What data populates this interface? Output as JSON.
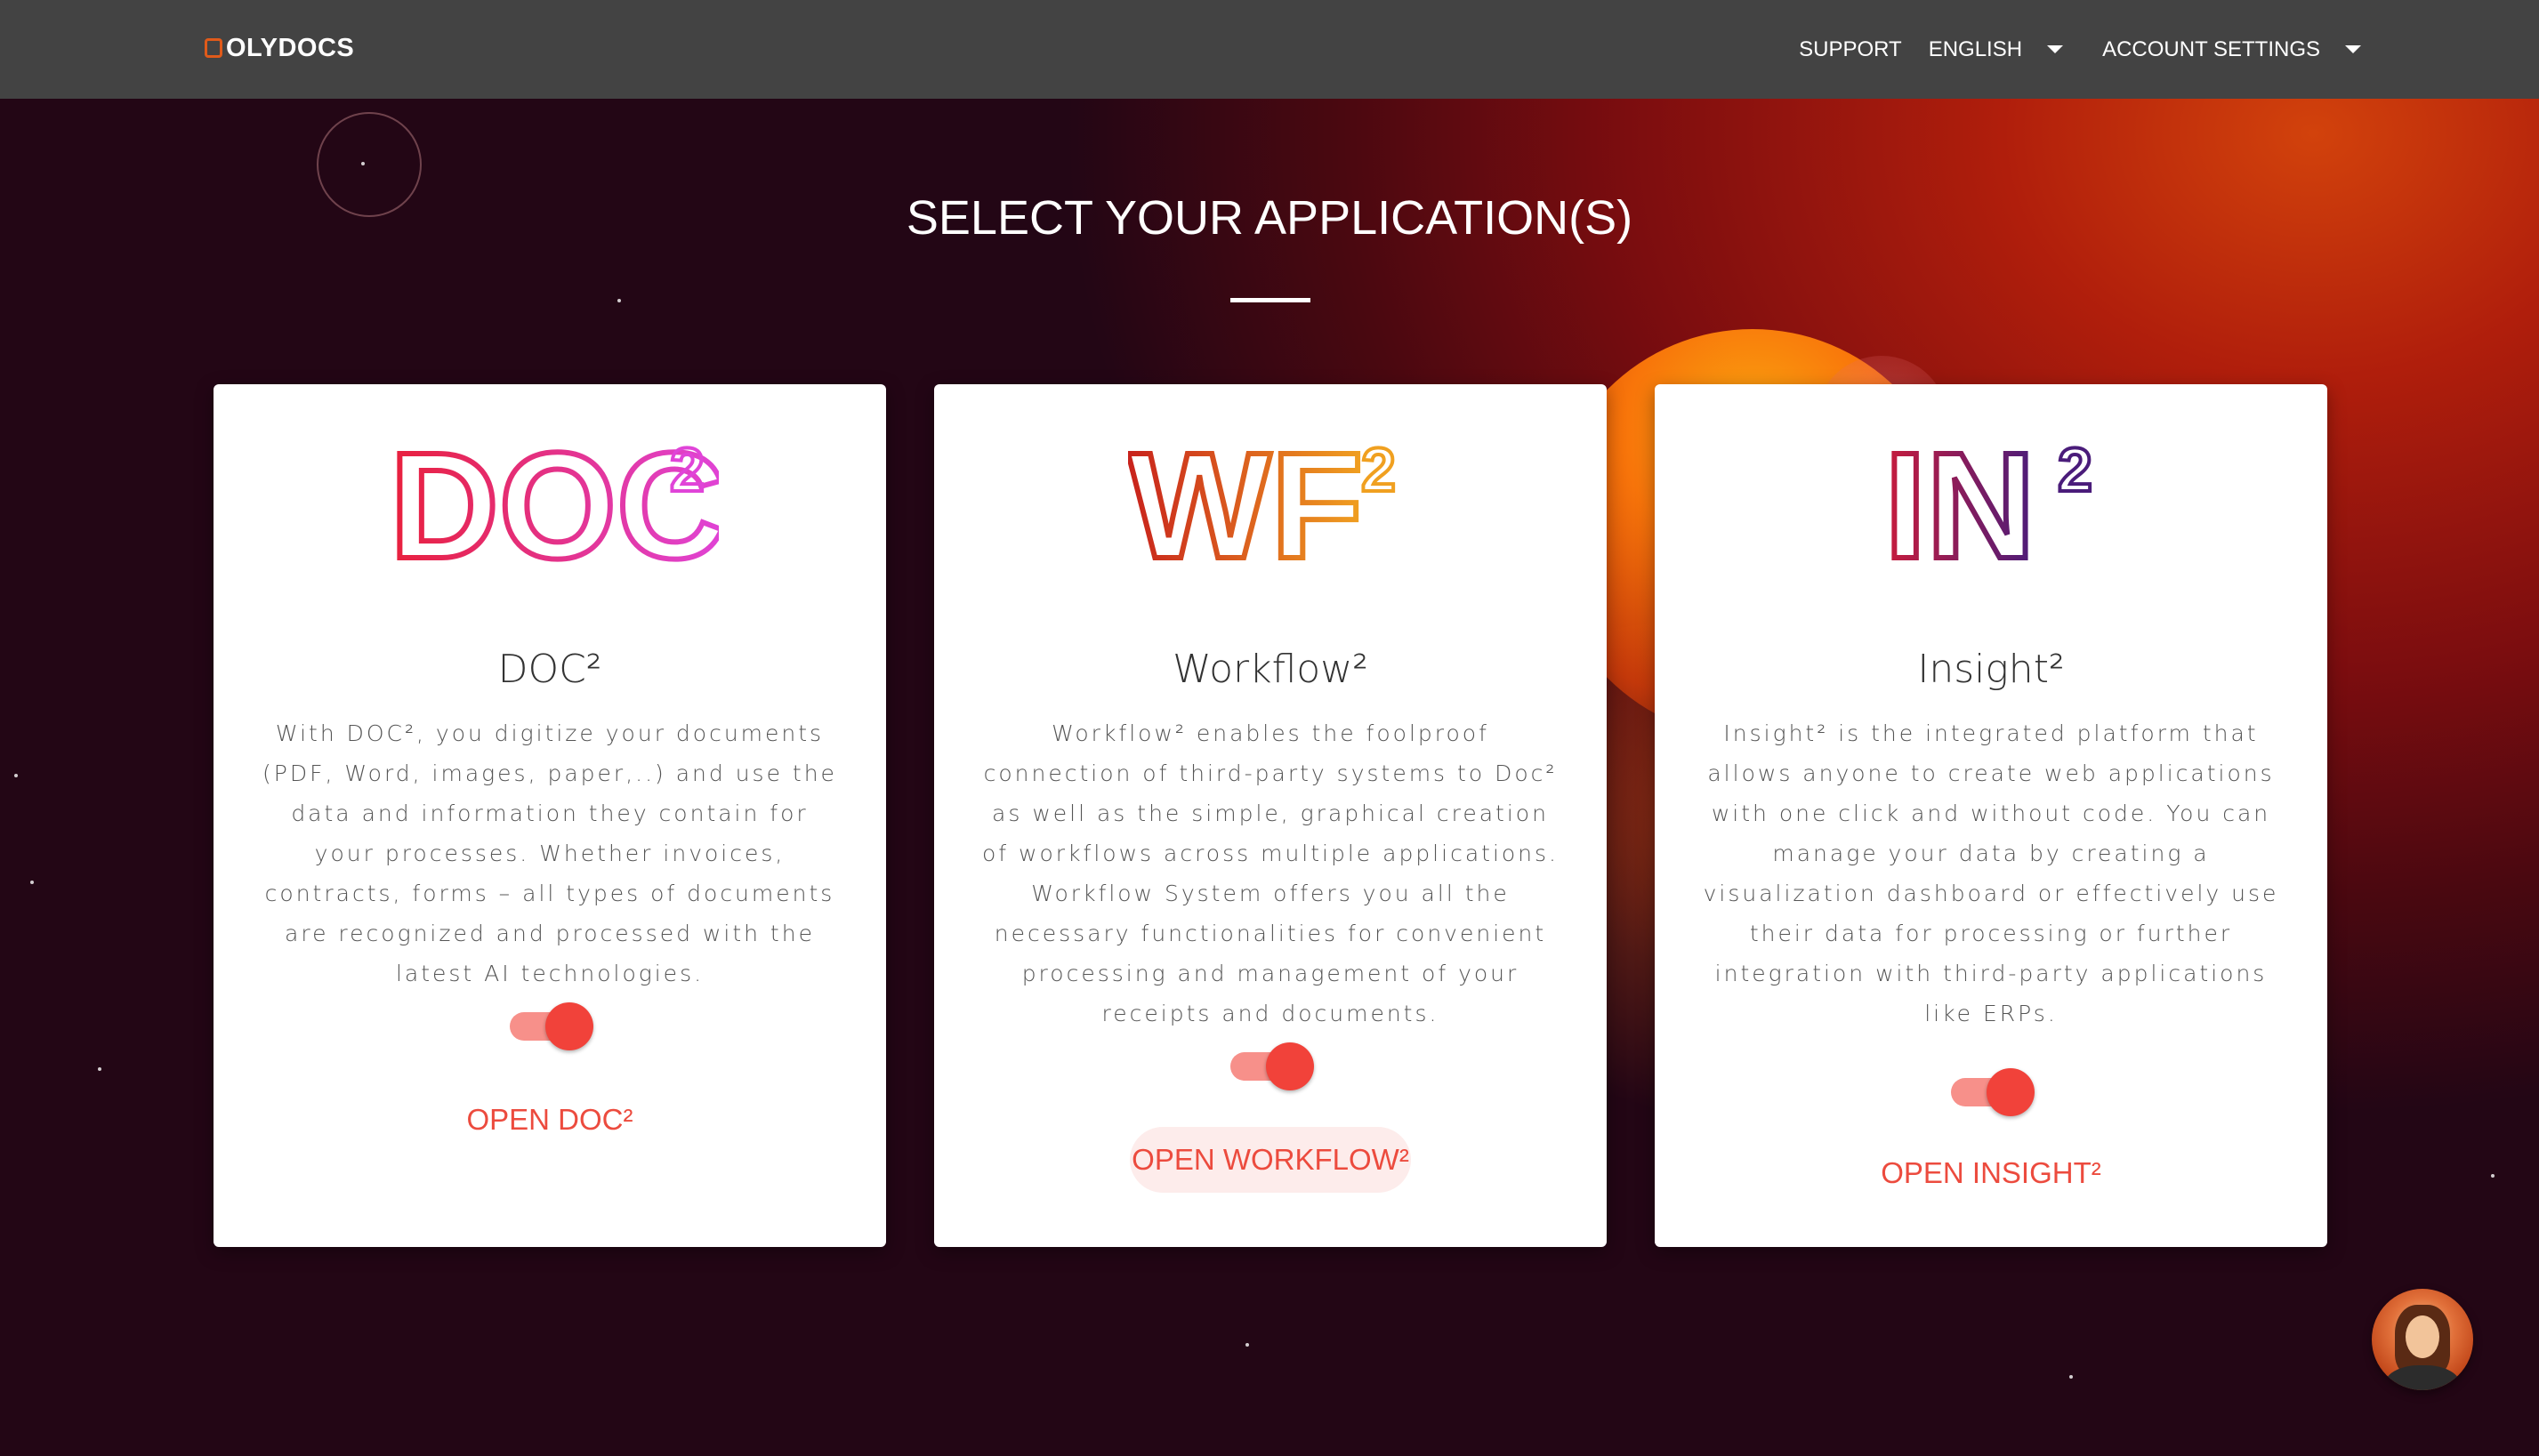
{
  "header": {
    "logo_text": "OLYDOCS",
    "nav": {
      "support_label": "SUPPORT",
      "language_label": "ENGLISH",
      "account_label": "ACCOUNT SETTINGS"
    }
  },
  "page": {
    "title": "SELECT YOUR APPLICATION(S)"
  },
  "apps": [
    {
      "name": "DOC²",
      "logo_text": "DOC",
      "logo_sup": "2",
      "logo_colors": [
        "#e8203c",
        "#e044d8"
      ],
      "description": "With DOC², you digitize your documents (PDF, Word, images, paper,..) and use the data and information they contain for your processes. Whether invoices, contracts, forms – all types of documents are recognized and processed with the latest AI technologies.",
      "enabled": true,
      "open_label": "OPEN DOC²"
    },
    {
      "name": "Workflow²",
      "logo_text": "WF",
      "logo_sup": "2",
      "logo_colors": [
        "#c8221c",
        "#f0a020"
      ],
      "description": "Workflow² enables the foolproof connection of third-party systems to Doc² as well as the simple, graphical creation of workflows across multiple applications. Workflow System offers you all the necessary functionalities for convenient processing and management of your receipts and documents.",
      "enabled": true,
      "open_label": "OPEN WORKFLOW²"
    },
    {
      "name": "Insight²",
      "logo_text": "IN",
      "logo_sup": "2",
      "logo_colors": [
        "#c81c3c",
        "#4a1c7a"
      ],
      "description": "Insight² is the integrated platform that allows anyone to create web applications with one click and without code. You can manage your data by creating a visualization dashboard or effectively use their data for processing or further integration with third-party applications like ERPs.",
      "enabled": true,
      "open_label": "OPEN INSIGHT²"
    }
  ],
  "theme": {
    "accent": "#ec4b3e",
    "toggle_on": "#f1423a",
    "topbar": "#434343"
  }
}
